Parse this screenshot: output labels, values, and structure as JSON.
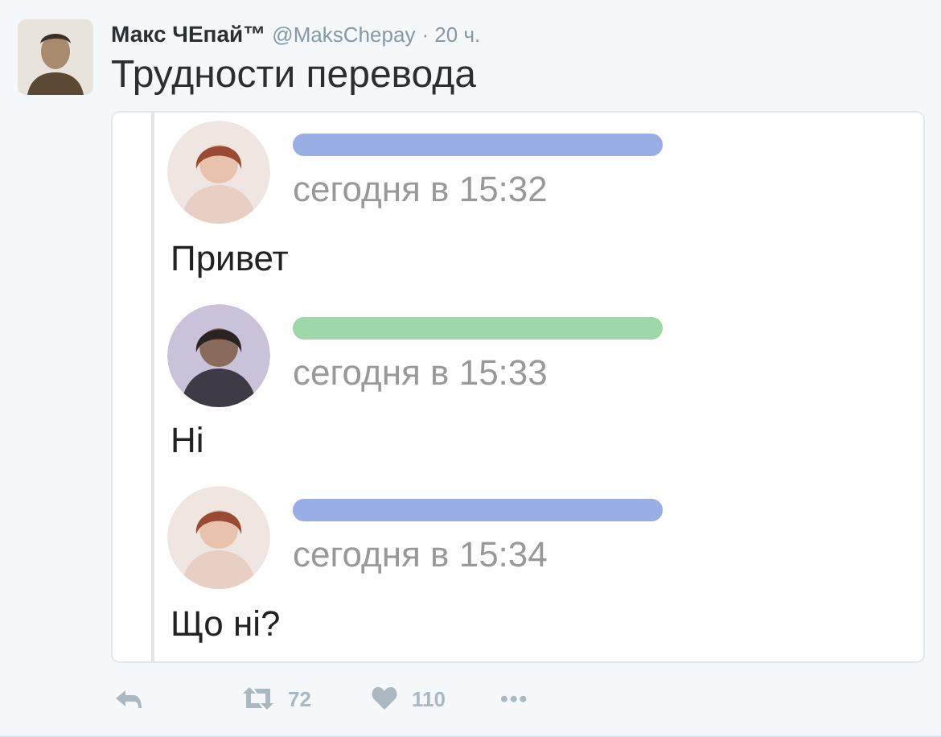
{
  "tweet": {
    "author": "Макс ЧЕпай™",
    "handle": "@MaksChepay",
    "time": "· 20 ч.",
    "text": "Трудности перевода"
  },
  "chat": {
    "messages": [
      {
        "color": "#9aaee6",
        "time": "сегодня в 15:32",
        "text": "Привет"
      },
      {
        "color": "#9fd8a8",
        "time": "сегодня в 15:33",
        "text": "Ні"
      },
      {
        "color": "#9aaee6",
        "time": "сегодня в 15:34",
        "text": "Що ні?"
      }
    ]
  },
  "actions": {
    "retweets": "72",
    "likes": "110",
    "more": "•••"
  }
}
